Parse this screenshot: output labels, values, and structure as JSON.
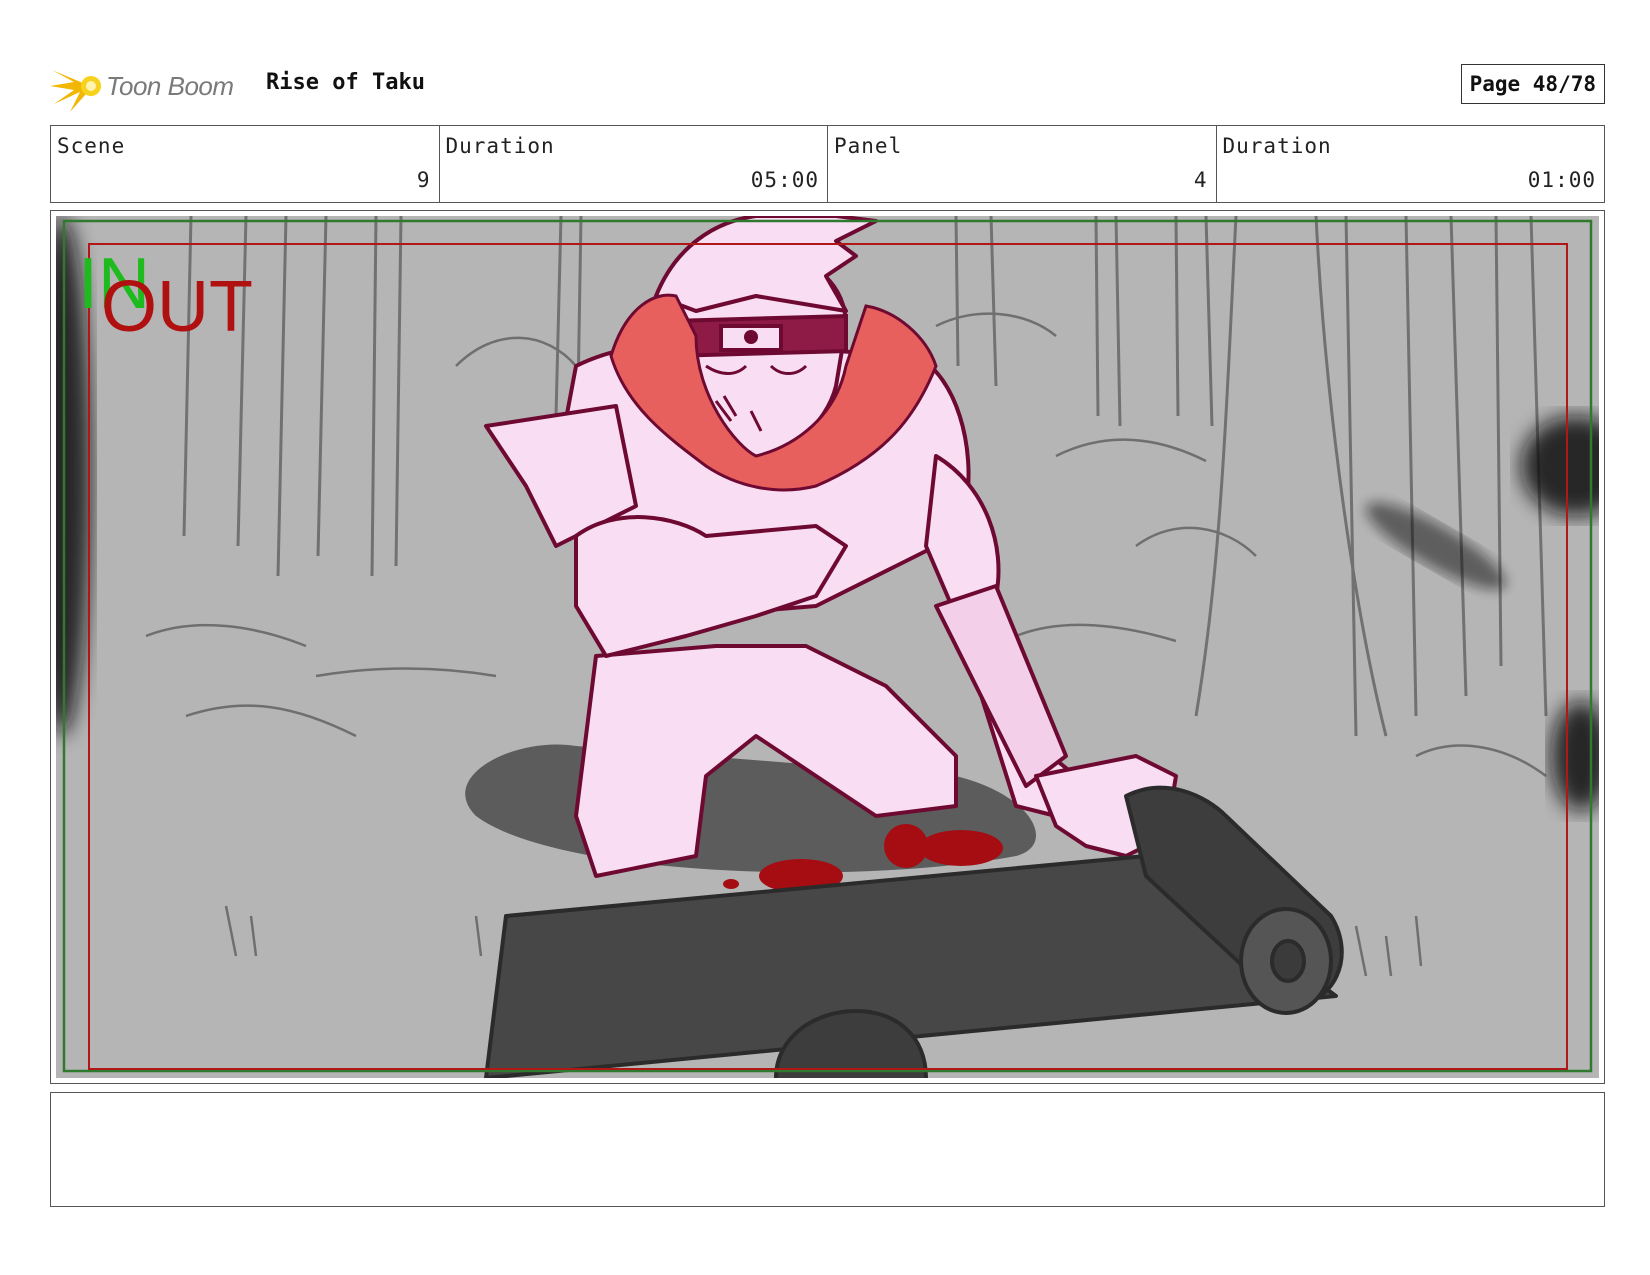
{
  "header": {
    "logo_text": "Toon Boom",
    "project_title": "Rise of Taku",
    "page_label": "Page 48/78"
  },
  "info": {
    "scene_label": "Scene",
    "scene_value": "9",
    "scene_duration_label": "Duration",
    "scene_duration_value": "05:00",
    "panel_label": "Panel",
    "panel_value": "4",
    "panel_duration_label": "Duration",
    "panel_duration_value": "01:00"
  },
  "panel": {
    "in_marker": "IN",
    "out_marker": "OUT",
    "colors": {
      "background": "#b5b5b5",
      "character_fill": "#f8ddf3",
      "character_outline": "#6e0a32",
      "scarf": "#e8605d",
      "blood": "#a50d12",
      "scroll": "#474747",
      "shadow": "#5c5c5c",
      "safe_frame_green": "#2f7a2f",
      "safe_frame_red": "#b01818"
    }
  },
  "notes": {
    "text": ""
  }
}
